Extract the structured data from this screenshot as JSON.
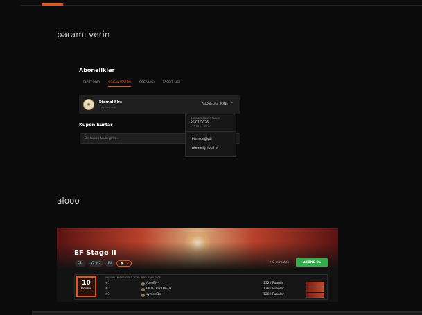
{
  "posts": {
    "first_text": "paramı verin",
    "second_text": "alooo"
  },
  "subscriptions": {
    "title": "Abonelikler",
    "tabs": [
      {
        "label": "PLATFORM"
      },
      {
        "label": "ORGANIZATÖR"
      },
      {
        "label": "ESEA LIGI"
      },
      {
        "label": "FACEIT LIGI"
      }
    ],
    "card": {
      "name": "Eternal Fire",
      "meta": "1 ay Abonelik",
      "manage_label": "ABONELIĞI YÖNET ⌃"
    },
    "dropdown": {
      "label": "SONRAKI ÖDEME TARIHI",
      "date": "25/01/2026",
      "sub": "₺79,99 / 1 AYLIK",
      "item1": "Planı değiştir",
      "item2": "Aboneliği iptal et"
    },
    "coupon_title": "Kupon kurtar",
    "coupon_placeholder": "Bir kupon kodu girin..."
  },
  "event": {
    "title": "EF Stage II",
    "tags": [
      "CS2",
      "V5 5v5",
      "EU",
      "⌚ 12"
    ],
    "in_match": "✕ 0 in match",
    "join_label": "ABONE OL",
    "count": "10",
    "count_label": "Ödüller",
    "board_head": "JANUARY LEADERBOARD 2026 · BITIŞ: 25/01/2026",
    "ranks": [
      {
        "pos": "#1",
        "team": "AzroBN-",
        "points": "1322 Puanlar"
      },
      {
        "pos": "#2",
        "team": "ENTELORANGTN",
        "points": "1281 Puanlar"
      },
      {
        "pos": "#3",
        "team": "symetr1c",
        "points": "1289 Puanlar"
      }
    ]
  },
  "colors": {
    "accent": "#e8531c",
    "join": "#2fae4b",
    "background": "#0b0b0b"
  }
}
